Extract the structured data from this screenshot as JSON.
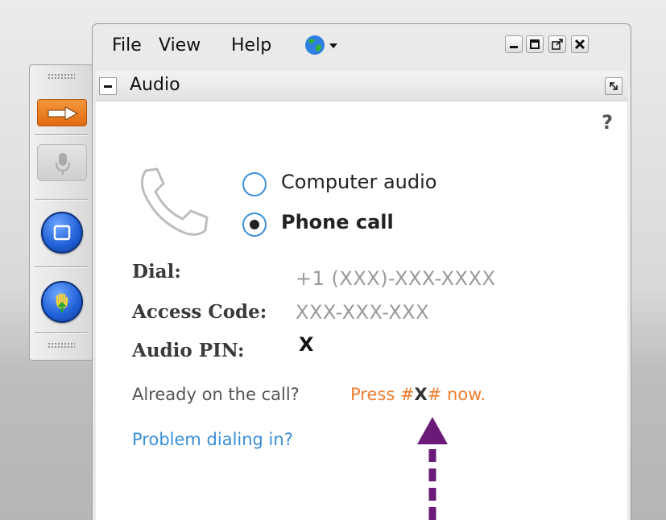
{
  "menu": {
    "file": "File",
    "view": "View",
    "help": "Help"
  },
  "panel": {
    "title": "Audio",
    "help": "?"
  },
  "audio_options": [
    {
      "label": "Computer audio",
      "selected": false
    },
    {
      "label": "Phone call",
      "selected": true
    }
  ],
  "dial": {
    "label": "Dial:",
    "value": "+1 (XXX)-XXX-XXXX"
  },
  "access_code": {
    "label": "Access Code:",
    "value": "XXX-XXX-XXX"
  },
  "audio_pin": {
    "label": "Audio PIN:",
    "value": "X"
  },
  "already": {
    "prompt": "Already on the call?",
    "press_prefix": "Press #",
    "press_code": "X",
    "press_suffix": "# now."
  },
  "problem_link": "Problem dialing in?",
  "colors": {
    "accent_blue": "#3a8fd8",
    "accent_orange": "#f07d2e",
    "annotation_purple": "#6a1b78"
  },
  "icons": [
    "share-arrow-icon",
    "microphone-icon",
    "video-icon",
    "raise-hand-icon",
    "globe-icon",
    "phone-handset-icon"
  ]
}
